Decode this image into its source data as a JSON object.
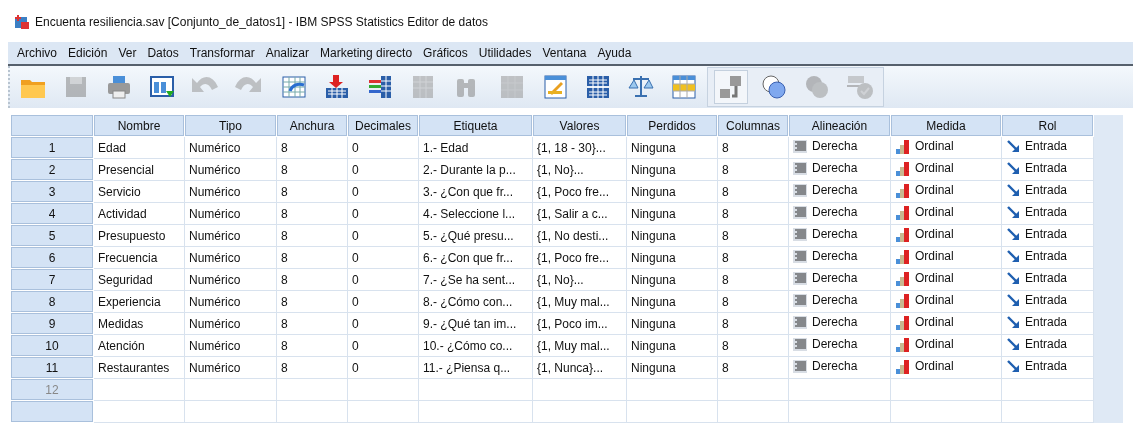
{
  "window": {
    "title": "Encuenta resiliencia.sav [Conjunto_de_datos1] - IBM SPSS Statistics Editor de datos"
  },
  "menu": [
    "Archivo",
    "Edición",
    "Ver",
    "Datos",
    "Transformar",
    "Analizar",
    "Marketing directo",
    "Gráficos",
    "Utilidades",
    "Ventana",
    "Ayuda"
  ],
  "toolbar": [
    {
      "disabled": false,
      "pressed": false
    },
    {
      "disabled": true,
      "pressed": false
    },
    {
      "disabled": false,
      "pressed": false
    },
    {
      "disabled": false,
      "pressed": false
    },
    {
      "disabled": true,
      "pressed": false
    },
    {
      "disabled": true,
      "pressed": false
    },
    {
      "disabled": false,
      "pressed": false
    },
    {
      "disabled": false,
      "pressed": false
    },
    {
      "disabled": false,
      "pressed": false
    },
    {
      "disabled": true,
      "pressed": false
    },
    {
      "disabled": true,
      "pressed": false
    },
    {
      "disabled": true,
      "pressed": false
    },
    {
      "disabled": false,
      "pressed": false
    },
    {
      "disabled": false,
      "pressed": false
    },
    {
      "disabled": false,
      "pressed": false
    },
    {
      "disabled": false,
      "pressed": false
    },
    {
      "disabled": false,
      "pressed": true
    },
    {
      "disabled": false,
      "pressed": false
    },
    {
      "disabled": true,
      "pressed": false
    },
    {
      "disabled": true,
      "pressed": false
    }
  ],
  "table": {
    "columns": [
      "Nombre",
      "Tipo",
      "Anchura",
      "Decimales",
      "Etiqueta",
      "Valores",
      "Perdidos",
      "Columnas",
      "Alineación",
      "Medida",
      "Rol"
    ],
    "rows": [
      {
        "number": "1",
        "cells": [
          "Edad",
          "Numérico",
          "8",
          "0",
          "1.- Edad",
          "{1, 18 - 30}...",
          "Ninguna",
          "8",
          "Derecha",
          "Ordinal",
          "Entrada"
        ]
      },
      {
        "number": "2",
        "cells": [
          "Presencial",
          "Numérico",
          "8",
          "0",
          "2.- Durante la p...",
          "{1, No}...",
          "Ninguna",
          "8",
          "Derecha",
          "Ordinal",
          "Entrada"
        ]
      },
      {
        "number": "3",
        "cells": [
          "Servicio",
          "Numérico",
          "8",
          "0",
          "3.- ¿Con que fr...",
          "{1, Poco fre...",
          "Ninguna",
          "8",
          "Derecha",
          "Ordinal",
          "Entrada"
        ]
      },
      {
        "number": "4",
        "cells": [
          "Actividad",
          "Numérico",
          "8",
          "0",
          "4.- Seleccione l...",
          "{1, Salir a c...",
          "Ninguna",
          "8",
          "Derecha",
          "Ordinal",
          "Entrada"
        ]
      },
      {
        "number": "5",
        "cells": [
          "Presupuesto",
          "Numérico",
          "8",
          "0",
          "5.- ¿Qué presu...",
          "{1, No desti...",
          "Ninguna",
          "8",
          "Derecha",
          "Ordinal",
          "Entrada"
        ]
      },
      {
        "number": "6",
        "cells": [
          "Frecuencia",
          "Numérico",
          "8",
          "0",
          "6.- ¿Con que fr...",
          "{1, Poco fre...",
          "Ninguna",
          "8",
          "Derecha",
          "Ordinal",
          "Entrada"
        ]
      },
      {
        "number": "7",
        "cells": [
          "Seguridad",
          "Numérico",
          "8",
          "0",
          "7.- ¿Se ha sent...",
          "{1, No}...",
          "Ninguna",
          "8",
          "Derecha",
          "Ordinal",
          "Entrada"
        ]
      },
      {
        "number": "8",
        "cells": [
          "Experiencia",
          "Numérico",
          "8",
          "0",
          "8.- ¿Cómo con...",
          "{1, Muy mal...",
          "Ninguna",
          "8",
          "Derecha",
          "Ordinal",
          "Entrada"
        ]
      },
      {
        "number": "9",
        "cells": [
          "Medidas",
          "Numérico",
          "8",
          "0",
          "9.- ¿Qué tan im...",
          "{1, Poco im...",
          "Ninguna",
          "8",
          "Derecha",
          "Ordinal",
          "Entrada"
        ]
      },
      {
        "number": "10",
        "cells": [
          "Atención",
          "Numérico",
          "8",
          "0",
          "10.- ¿Cómo co...",
          "{1, Muy mal...",
          "Ninguna",
          "8",
          "Derecha",
          "Ordinal",
          "Entrada"
        ]
      },
      {
        "number": "11",
        "cells": [
          "Restaurantes",
          "Numérico",
          "8",
          "0",
          "11.- ¿Piensa q...",
          "{1, Nunca}...",
          "Ninguna",
          "8",
          "Derecha",
          "Ordinal",
          "Entrada"
        ]
      },
      {
        "number": "12",
        "cells": []
      }
    ]
  }
}
